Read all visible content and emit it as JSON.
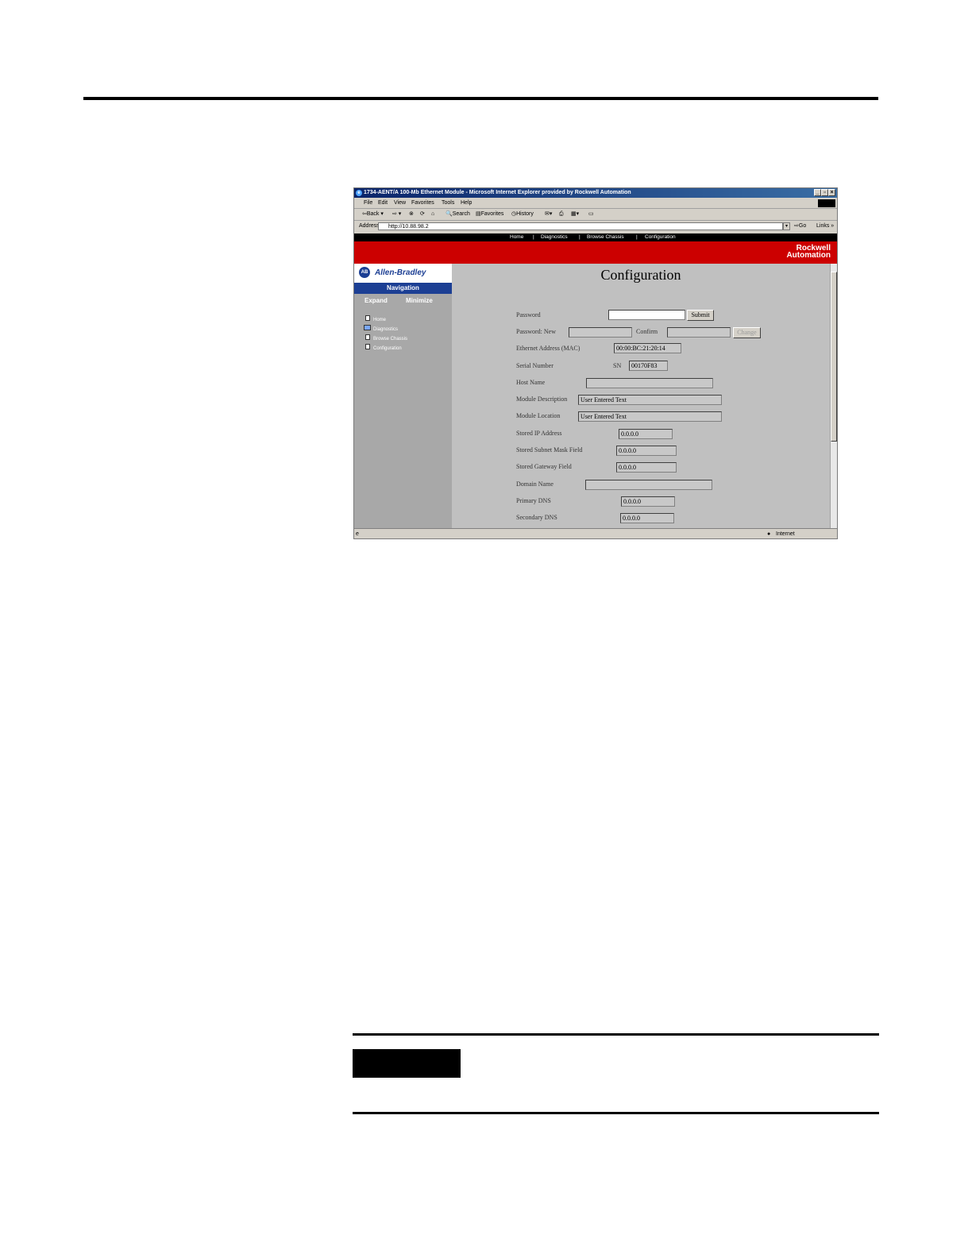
{
  "browser": {
    "title": "1734-AENT/A 100-Mb Ethernet Module - Microsoft Internet Explorer provided by Rockwell Automation",
    "menu": [
      "File",
      "Edit",
      "View",
      "Favorites",
      "Tools",
      "Help"
    ],
    "toolbar": {
      "back": "Back",
      "search": "Search",
      "favorites": "Favorites",
      "history": "History"
    },
    "address_label": "Address",
    "address_value": "http://10.88.98.2",
    "go_label": "Go",
    "links_label": "Links",
    "status_zone": "Internet"
  },
  "site": {
    "topnav": [
      "Home",
      "Diagnostics",
      "Browse Chassis",
      "Configuration"
    ],
    "brand_line1": "Rockwell",
    "brand_line2": "Automation",
    "ab_logo_text": "AB",
    "ab_brand": "Allen-Bradley"
  },
  "sidebar": {
    "header": "Navigation",
    "expand": "Expand",
    "minimize": "Minimize",
    "links": [
      "Home",
      "Diagnostics",
      "Browse Chassis",
      "Configuration"
    ]
  },
  "form": {
    "title": "Configuration",
    "password_label": "Password",
    "submit_label": "Submit",
    "password_new_label": "Password: New",
    "confirm_label": "Confirm",
    "change_label": "Change",
    "mac_label": "Ethernet Address (MAC)",
    "mac_value": "00:00:BC:21:20:14",
    "serial_label": "Serial Number",
    "sn_label": "SN",
    "sn_value": "00170F83",
    "host_label": "Host Name",
    "host_value": "",
    "desc_label": "Module Description",
    "desc_value": "User Entered Text",
    "loc_label": "Module Location",
    "loc_value": "User Entered Text",
    "ip_label": "Stored IP Address",
    "ip_value": "0.0.0.0",
    "mask_label": "Stored Subnet Mask Field",
    "mask_value": "0.0.0.0",
    "gw_label": "Stored Gateway Field",
    "gw_value": "0.0.0.0",
    "domain_label": "Domain Name",
    "domain_value": "",
    "dns1_label": "Primary DNS",
    "dns1_value": "0.0.0.0",
    "dns2_label": "Secondary DNS",
    "dns2_value": "0.0.0.0"
  }
}
